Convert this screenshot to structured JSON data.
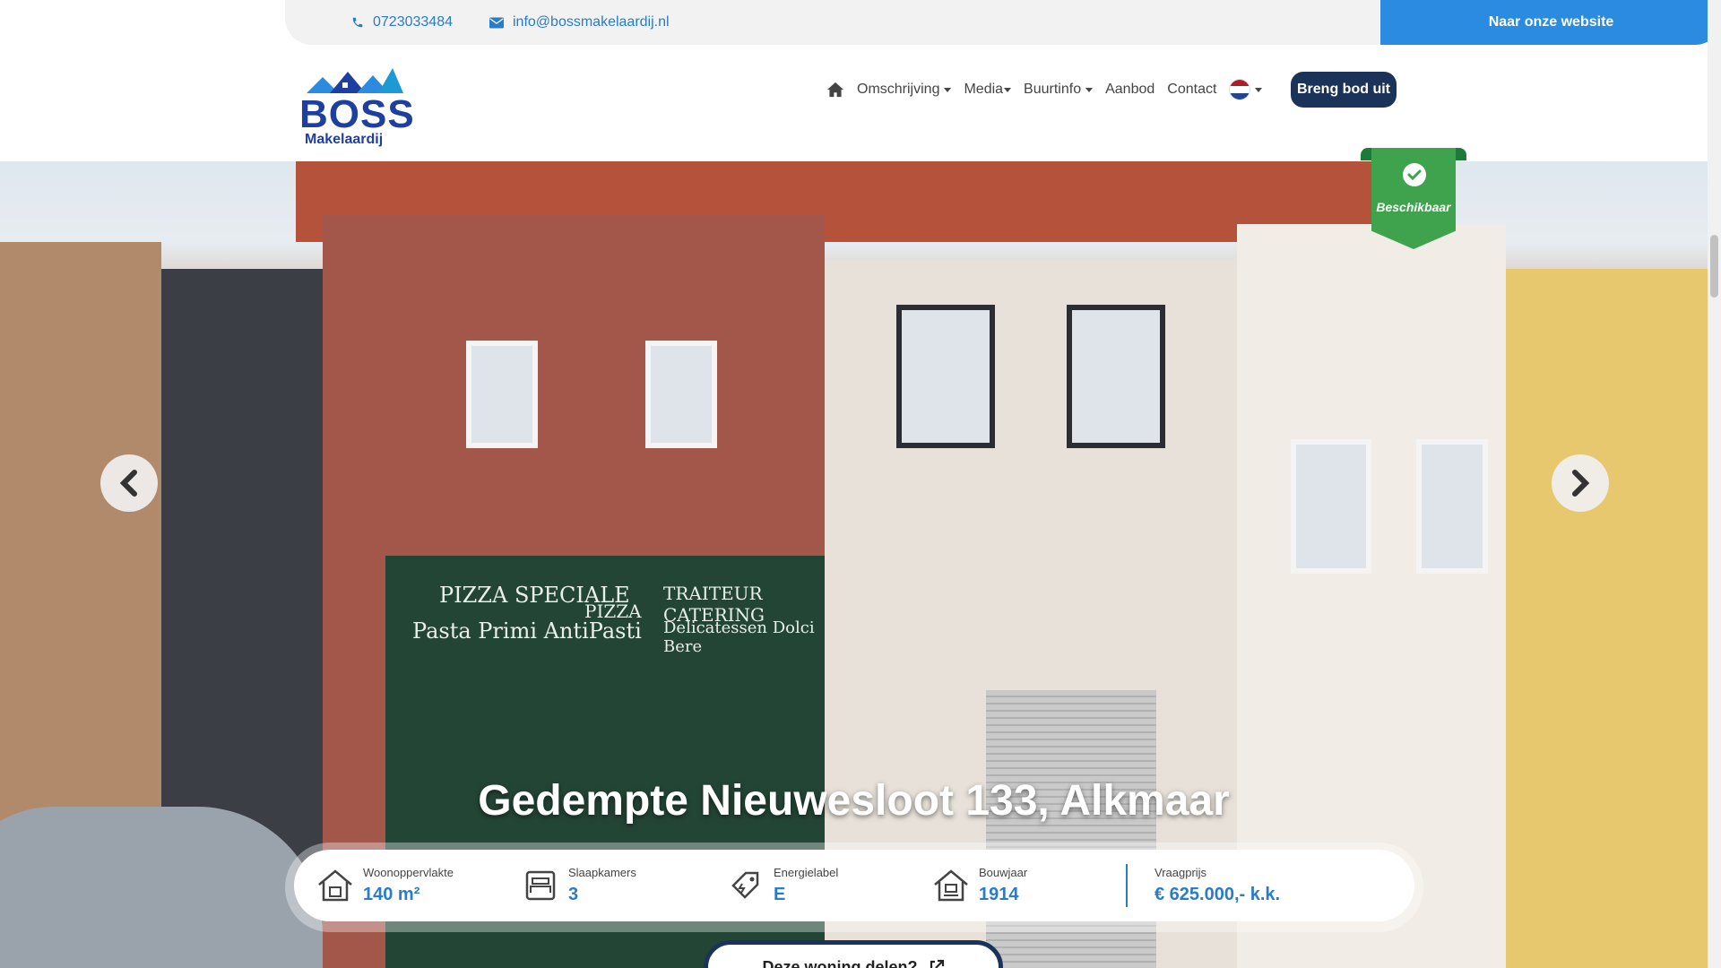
{
  "topbar": {
    "phone": "0723033484",
    "email": "info@bossmakelaardij.nl",
    "website_button": "Naar onze website"
  },
  "logo": {
    "brand": "BOSS",
    "sub": "Makelaardij"
  },
  "nav": {
    "items": [
      {
        "label": "Omschrijving",
        "dropdown": true
      },
      {
        "label": "Media",
        "dropdown": true
      },
      {
        "label": "Buurtinfo",
        "dropdown": true
      },
      {
        "label": "Aanbod",
        "dropdown": false
      },
      {
        "label": "Contact",
        "dropdown": false
      }
    ],
    "bid_button": "Breng bod uit"
  },
  "hero": {
    "status_ribbon": "Beschikbaar",
    "address": "Gedempte Nieuwesloot 133, Alkmaar",
    "shop_sign_left_1": "PIZZA SPECIALE",
    "shop_sign_left_2": "Pasta Primi AntiPasti",
    "shop_sign_logo": "PIZZA",
    "shop_sign_right_1": "TRAITEUR CATERING",
    "shop_sign_right_2": "Delicatessen Dolci Bere"
  },
  "stats": [
    {
      "label": "Woonoppervlakte",
      "value": "140 m²",
      "icon": "house-area-icon"
    },
    {
      "label": "Slaapkamers",
      "value": "3",
      "icon": "bed-icon"
    },
    {
      "label": "Energielabel",
      "value": "E",
      "icon": "energy-tag-icon"
    },
    {
      "label": "Bouwjaar",
      "value": "1914",
      "icon": "house-year-icon"
    },
    {
      "label": "Vraagprijs",
      "value": "€ 625.000,- k.k."
    }
  ],
  "share_button": "Deze woning delen?",
  "colors": {
    "accent": "#2a7bc8",
    "website_button": "#2a8be0",
    "dark_navy": "#1c3359",
    "available_green": "#3fa34d"
  }
}
